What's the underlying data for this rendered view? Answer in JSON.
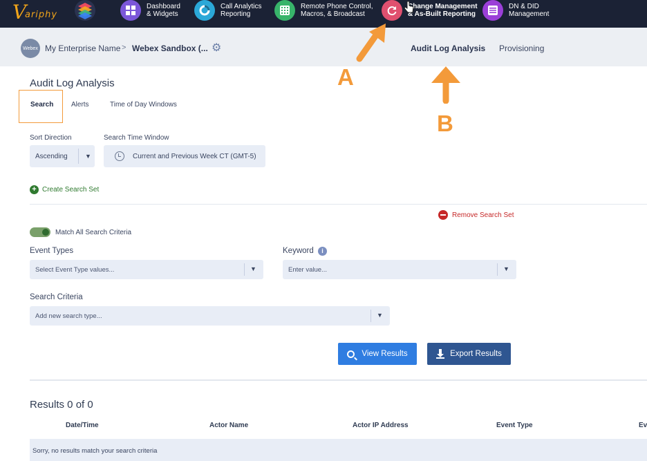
{
  "nav": {
    "logo_text": "ariphy",
    "items": [
      {
        "label": "Dashboard\n& Widgets",
        "color": "#7b57d9"
      },
      {
        "label": "Call Analytics\nReporting",
        "color": "#2ba8d8"
      },
      {
        "label": "Remote Phone Control,\nMacros, & Broadcast",
        "color": "#38b46a"
      },
      {
        "label": "Change Management\n& As-Built Reporting",
        "color": "#e0506f"
      },
      {
        "label": "DN & DID\nManagement",
        "color": "#9b3fd8"
      }
    ]
  },
  "breadcrumb": {
    "avatar_text": "Webex",
    "enterprise": "My Enterprise Name",
    "separator": ">",
    "site": "Webex Sandbox (...",
    "tabs": {
      "audit": "Audit Log Analysis",
      "provisioning": "Provisioning"
    }
  },
  "page": {
    "title": "Audit Log Analysis",
    "subtabs": {
      "search": "Search",
      "alerts": "Alerts",
      "tod": "Time of Day Windows"
    }
  },
  "form": {
    "sort_label": "Sort Direction",
    "sort_value": "Ascending",
    "window_label": "Search Time Window",
    "window_value": "Current and Previous Week CT (GMT-5)",
    "create_set": "Create Search Set",
    "remove_set": "Remove Search Set",
    "match_all": "Match All Search Criteria",
    "event_types_label": "Event Types",
    "event_types_placeholder": "Select Event Type values...",
    "keyword_label": "Keyword",
    "keyword_placeholder": "Enter value...",
    "criteria_label": "Search Criteria",
    "criteria_placeholder": "Add new search type...",
    "view_results": "View Results",
    "export_results": "Export Results"
  },
  "results": {
    "title": "Results 0 of 0",
    "columns": [
      "Date/Time",
      "Actor Name",
      "Actor IP Address",
      "Event Type",
      "Ev"
    ],
    "empty_message": "Sorry, no results match your search criteria"
  },
  "annotations": {
    "a": "A",
    "b": "B",
    "color": "#f39a3a"
  }
}
